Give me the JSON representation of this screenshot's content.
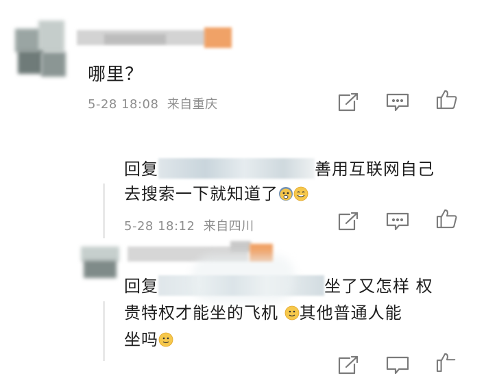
{
  "comment": {
    "text": "哪里？",
    "time": "5-28 18:08",
    "location": "来自重庆"
  },
  "replies": [
    {
      "line1_prefix": "回复",
      "line1_suffix": "善用互联网自己",
      "line2": "去搜索一下就知道了",
      "time": "5-28 18:12",
      "location": "来自四川"
    },
    {
      "line1_prefix": "回复",
      "line1_suffix": "坐了又怎样 权",
      "line2_a": "贵特权才能坐的飞机",
      "line2_b": "其他普通人能",
      "line3": "坐吗"
    }
  ],
  "icons": {
    "share": "share-icon",
    "comment": "comment-icon",
    "like": "thumbs-up-icon",
    "emoji_fearful": "fearful-emoji-icon",
    "emoji_smile": "smile-emoji-icon",
    "emoji_slight": "slight-smile-emoji-icon"
  }
}
